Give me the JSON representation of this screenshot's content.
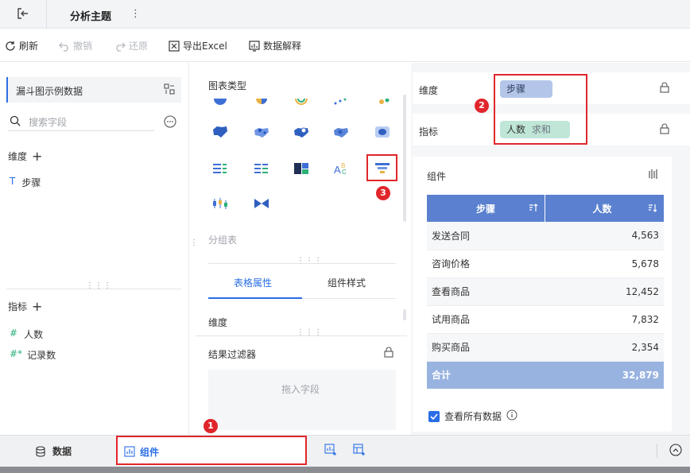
{
  "topbar": {
    "title": "分析主题",
    "more": "⋮"
  },
  "toolbar": {
    "refresh": "刷新",
    "undo": "撤销",
    "redo": "还原",
    "export": "导出Excel",
    "explain": "数据解释"
  },
  "left": {
    "dataset": "漏斗图示例数据",
    "search_placeholder": "搜索字段",
    "dim_header": "维度",
    "dim_items": [
      "步骤"
    ],
    "metric_header": "指标",
    "metric_items": [
      "人数",
      "记录数"
    ]
  },
  "mid": {
    "chart_type_title": "图表类型",
    "group_table": "分组表",
    "tab_table": "表格属性",
    "tab_style": "组件样式",
    "dim_label": "维度",
    "filter_title": "结果过滤器",
    "drop_hint": "拖入字段"
  },
  "right": {
    "dim_label": "维度",
    "dim_field": "步骤",
    "metric_label": "指标",
    "metric_field": "人数",
    "metric_agg": "求和",
    "component_label": "组件",
    "table_headers": [
      "步骤",
      "人数"
    ],
    "rows": [
      {
        "step": "发送合同",
        "count": "4,563"
      },
      {
        "step": "咨询价格",
        "count": "5,678"
      },
      {
        "step": "查看商品",
        "count": "12,452"
      },
      {
        "step": "试用商品",
        "count": "7,832"
      },
      {
        "step": "购买商品",
        "count": "2,354"
      }
    ],
    "total_label": "合计",
    "total_value": "32,879",
    "view_all": "查看所有数据"
  },
  "bottom": {
    "data_tab": "数据",
    "component_tab": "组件"
  },
  "badges": {
    "one": "1",
    "two": "2",
    "three": "3"
  },
  "colors": {
    "accent": "#2a6ee6",
    "header_blue": "#5a80cf",
    "total_blue": "#99b3e0",
    "annotation_red": "#e0262b"
  }
}
